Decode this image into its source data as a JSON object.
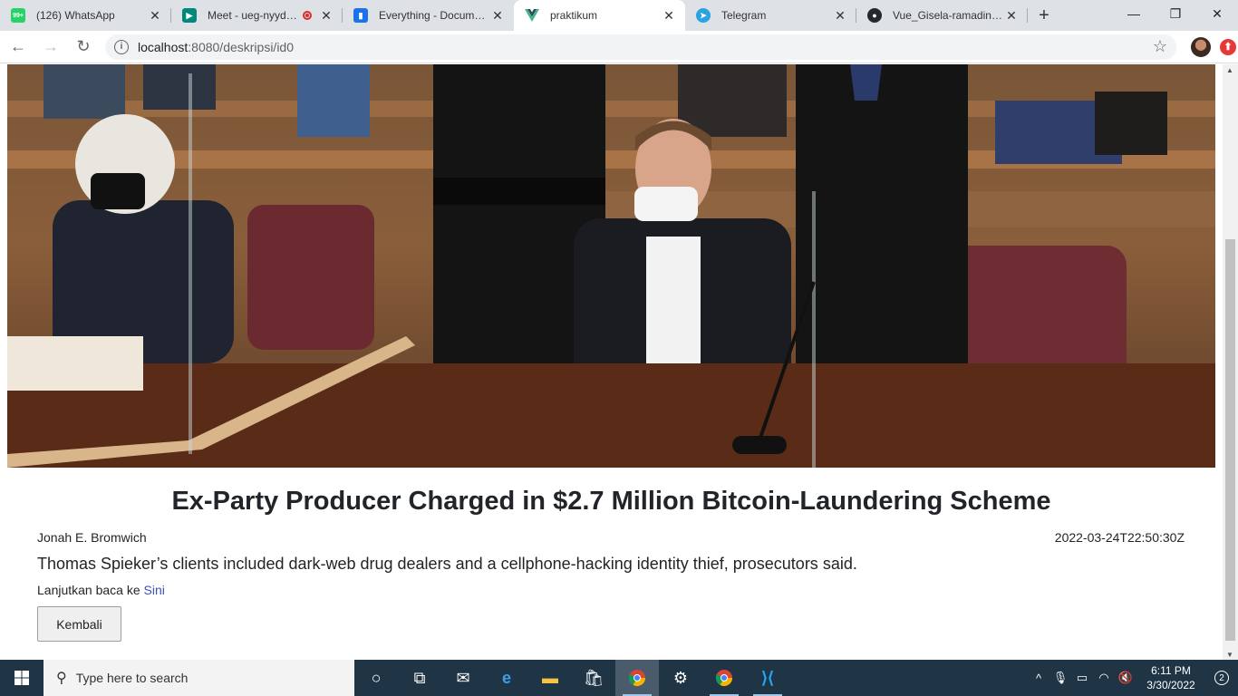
{
  "browser": {
    "tabs": [
      {
        "title": "(126) WhatsApp",
        "favicon": "whatsapp-icon",
        "favicon_text": "99+",
        "color": "#25d366"
      },
      {
        "title": "Meet - ueg-nyyd-zxx",
        "favicon": "meet-icon",
        "color": "#00897b",
        "recording": true
      },
      {
        "title": "Everything - Documents",
        "favicon": "docs-icon",
        "color": "#1a73e8"
      },
      {
        "title": "praktikum",
        "favicon": "vue-icon",
        "color": "#41b883",
        "active": true
      },
      {
        "title": "Telegram",
        "favicon": "telegram-icon",
        "color": "#2aa3e0"
      },
      {
        "title": "Vue_Gisela-ramadinawati",
        "favicon": "github-icon",
        "color": "#24292e"
      }
    ],
    "url_host": "localhost",
    "url_path": ":8080/deskripsi/id0"
  },
  "article": {
    "title": "Ex-Party Producer Charged in $2.7 Million Bitcoin-Laundering Scheme",
    "author": "Jonah E. Bromwich",
    "published": "2022-03-24T22:50:30Z",
    "description": "Thomas Spieker’s clients included dark-web drug dealers and a cellphone-hacking identity thief, prosecutors said.",
    "read_more_prefix": "Lanjutkan baca ke ",
    "read_more_link": "Sini",
    "back_label": "Kembali"
  },
  "taskbar": {
    "search_placeholder": "Type here to search",
    "time": "6:11 PM",
    "date": "3/30/2022",
    "notifications": "2"
  }
}
